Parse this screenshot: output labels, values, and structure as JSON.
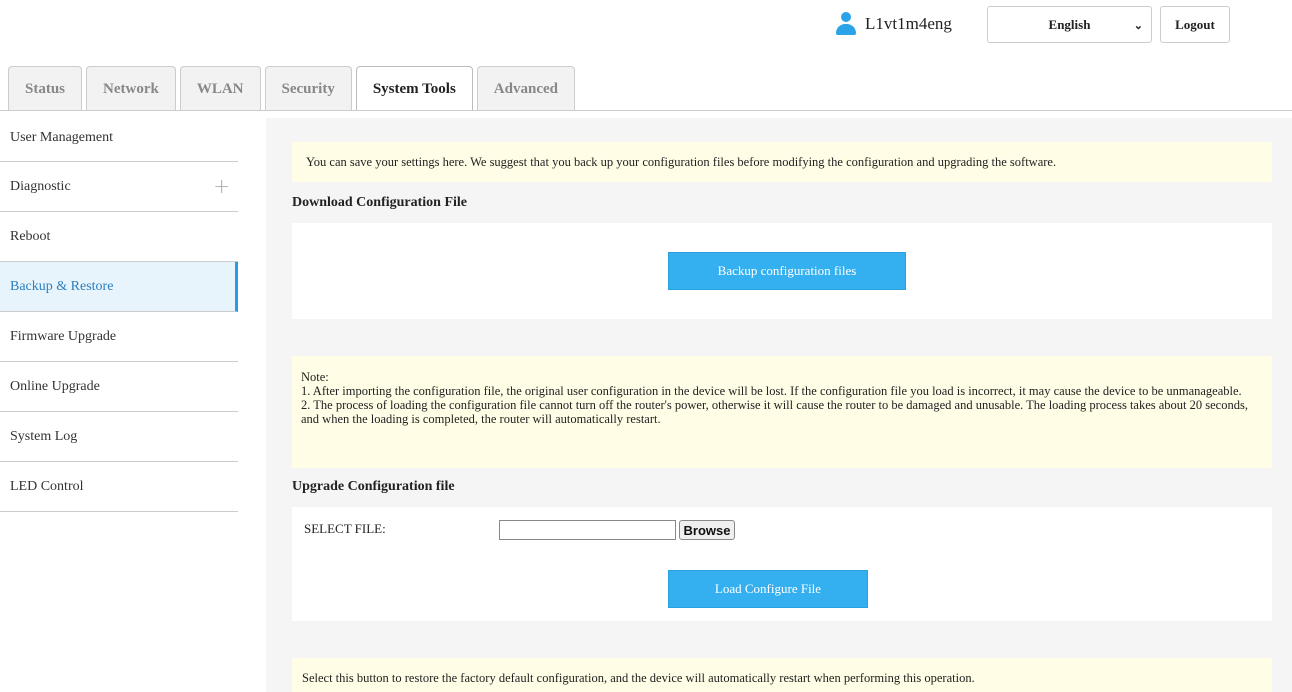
{
  "header": {
    "username": "L1vt1m4eng",
    "language": "English",
    "logout_label": "Logout",
    "icons": {
      "user": "user-icon",
      "language_dropdown": "chevron-down-icon"
    },
    "accent_color": "#2aa3e8"
  },
  "tabs": [
    {
      "label": "Status",
      "active": false
    },
    {
      "label": "Network",
      "active": false
    },
    {
      "label": "WLAN",
      "active": false
    },
    {
      "label": "Security",
      "active": false
    },
    {
      "label": "System Tools",
      "active": true
    },
    {
      "label": "Advanced",
      "active": false
    }
  ],
  "sidebar": {
    "items": [
      {
        "label": "User Management"
      },
      {
        "label": "Diagnostic",
        "expand_icon": "plus-icon"
      },
      {
        "label": "Reboot"
      },
      {
        "label": "Backup & Restore",
        "active": true
      },
      {
        "label": "Firmware Upgrade"
      },
      {
        "label": "Online Upgrade"
      },
      {
        "label": "System Log"
      },
      {
        "label": "LED Control"
      }
    ]
  },
  "main": {
    "intro_notice": "You can save your settings here. We suggest that you back up your configuration files before modifying the configuration and upgrading the software.",
    "download_title": "Download Configuration File",
    "backup_button": "Backup configuration files",
    "note": {
      "heading": "Note:",
      "line1": "1. After importing the configuration file, the original user configuration in the device will be lost. If the configuration file you load is incorrect, it may cause the device to be unmanageable.",
      "line2": "2. The process of loading the configuration file cannot turn off the router's power, otherwise it will cause the router to be damaged and unusable. The loading process takes about 20 seconds, and when the loading is completed, the router will automatically restart."
    },
    "upgrade_title": "Upgrade Configuration file",
    "select_file_label": "SELECT FILE:",
    "file_value": "",
    "browse_label": "Browse",
    "load_button": "Load Configure File",
    "factory_notice": "Select this button to restore the factory default configuration, and the device will automatically restart when performing this operation.",
    "button_color": "#34b0f0",
    "notice_color": "#fffde6"
  }
}
